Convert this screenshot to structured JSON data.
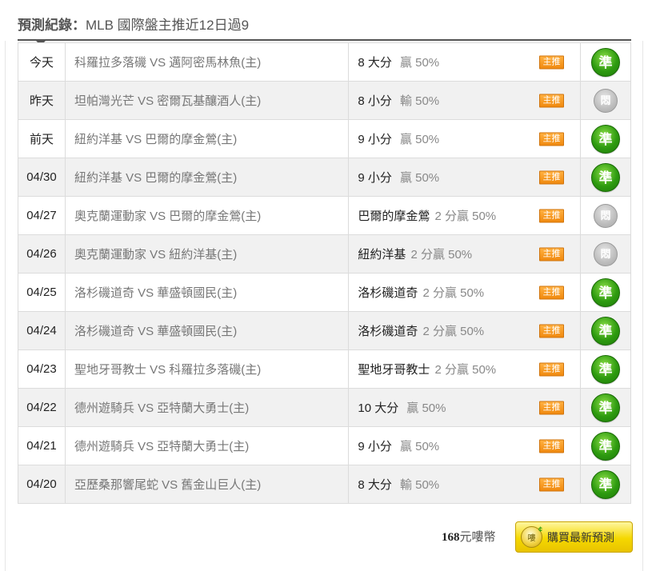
{
  "header": {
    "label": "預測紀錄：",
    "title": "MLB 國際盤主推近12日過9"
  },
  "host_tag": "主推",
  "rows": [
    {
      "date": "今天",
      "match": "科羅拉多落磯 VS 邁阿密馬林魚(主)",
      "pick": "8 大分",
      "odds": "贏 50%",
      "result": "準",
      "result_type": "win"
    },
    {
      "date": "昨天",
      "match": "坦帕灣光芒 VS 密爾瓦基釀酒人(主)",
      "pick": "8 小分",
      "odds": "輸 50%",
      "result": "悶",
      "result_type": "draw"
    },
    {
      "date": "前天",
      "match": "紐約洋基 VS 巴爾的摩金鶯(主)",
      "pick": "9 小分",
      "odds": "贏 50%",
      "result": "準",
      "result_type": "win"
    },
    {
      "date": "04/30",
      "match": "紐約洋基 VS 巴爾的摩金鶯(主)",
      "pick": "9 小分",
      "odds": "贏 50%",
      "result": "準",
      "result_type": "win"
    },
    {
      "date": "04/27",
      "match": "奧克蘭運動家 VS 巴爾的摩金鶯(主)",
      "pick": "巴爾的摩金鶯",
      "odds": "2 分贏 50%",
      "result": "悶",
      "result_type": "draw"
    },
    {
      "date": "04/26",
      "match": "奧克蘭運動家 VS 紐約洋基(主)",
      "pick": "紐約洋基",
      "odds": "2 分贏 50%",
      "result": "悶",
      "result_type": "draw"
    },
    {
      "date": "04/25",
      "match": "洛杉磯道奇 VS 華盛頓國民(主)",
      "pick": "洛杉磯道奇",
      "odds": "2 分贏 50%",
      "result": "準",
      "result_type": "win"
    },
    {
      "date": "04/24",
      "match": "洛杉磯道奇 VS 華盛頓國民(主)",
      "pick": "洛杉磯道奇",
      "odds": "2 分贏 50%",
      "result": "準",
      "result_type": "win"
    },
    {
      "date": "04/23",
      "match": "聖地牙哥教士 VS 科羅拉多落磯(主)",
      "pick": "聖地牙哥教士",
      "odds": "2 分贏 50%",
      "result": "準",
      "result_type": "win"
    },
    {
      "date": "04/22",
      "match": "德州遊騎兵 VS 亞特蘭大勇士(主)",
      "pick": "10 大分",
      "odds": "贏 50%",
      "result": "準",
      "result_type": "win"
    },
    {
      "date": "04/21",
      "match": "德州遊騎兵 VS 亞特蘭大勇士(主)",
      "pick": "9 小分",
      "odds": "贏 50%",
      "result": "準",
      "result_type": "win"
    },
    {
      "date": "04/20",
      "match": "亞歷桑那響尾蛇 VS 舊金山巨人(主)",
      "pick": "8 大分",
      "odds": "輸 50%",
      "result": "準",
      "result_type": "win"
    }
  ],
  "footer": {
    "price": "168",
    "unit": "元嘍幣",
    "buy_label": "購買最新預測",
    "coin_glyph": "嘍",
    "coin_cent": "¢"
  },
  "colors": {
    "win": "#2e9b10",
    "draw": "#bdbdbd",
    "host_tag": "#f08a10",
    "buy_button": "#f5d800"
  }
}
